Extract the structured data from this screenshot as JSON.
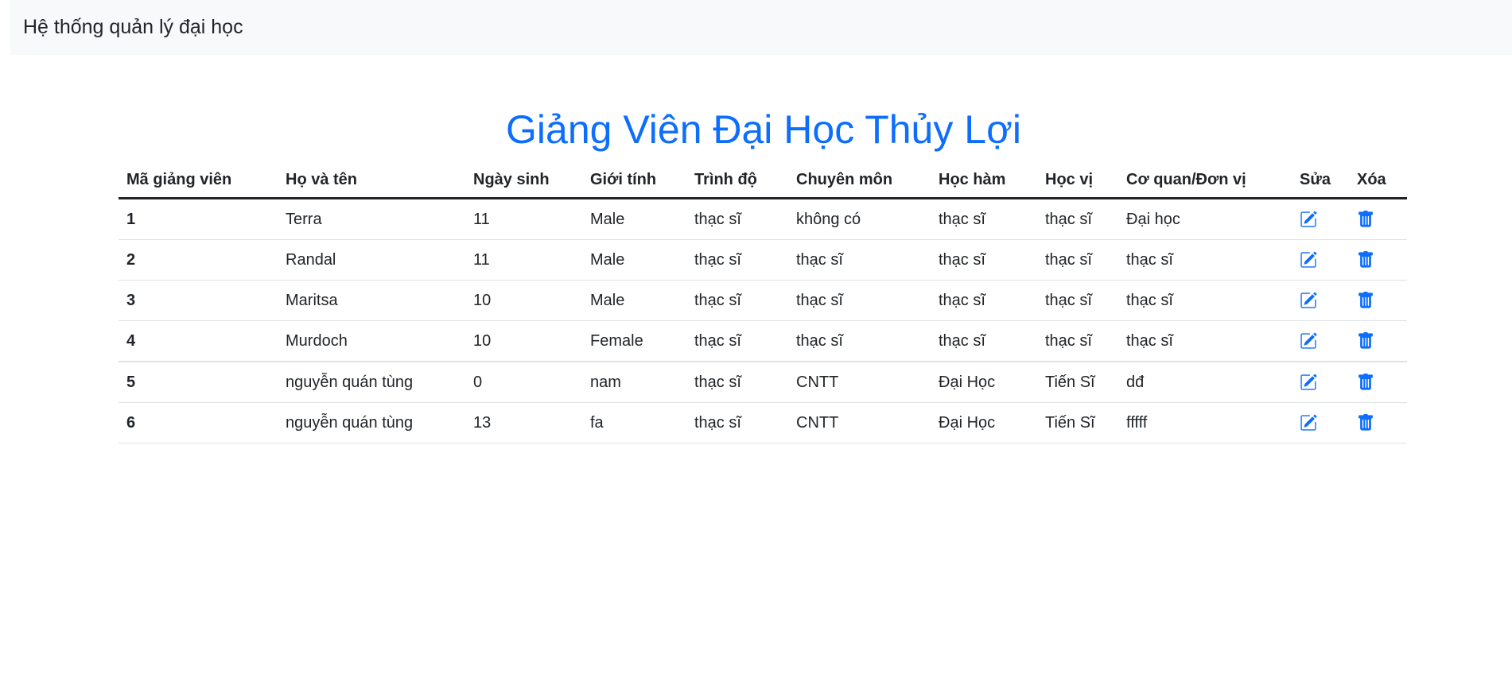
{
  "navbar": {
    "brand": "Hệ thống quản lý đại học"
  },
  "page": {
    "title": "Giảng Viên Đại Học Thủy Lợi"
  },
  "table": {
    "columns": [
      "Mã giảng viên",
      "Họ và tên",
      "Ngày sinh",
      "Giới tính",
      "Trình độ",
      "Chuyên môn",
      "Học hàm",
      "Học vị",
      "Cơ quan/Đơn vị",
      "Sửa",
      "Xóa"
    ],
    "rows": [
      {
        "id": "1",
        "name": "Terra",
        "dob": "11",
        "gender": "Male",
        "level": "thạc sĩ",
        "major": "không có",
        "rank": "thạc sĩ",
        "degree": "thạc sĩ",
        "unit": "Đại học"
      },
      {
        "id": "2",
        "name": "Randal",
        "dob": "11",
        "gender": "Male",
        "level": "thạc sĩ",
        "major": "thạc sĩ",
        "rank": "thạc sĩ",
        "degree": "thạc sĩ",
        "unit": "thạc sĩ"
      },
      {
        "id": "3",
        "name": "Maritsa",
        "dob": "10",
        "gender": "Male",
        "level": "thạc sĩ",
        "major": "thạc sĩ",
        "rank": "thạc sĩ",
        "degree": "thạc sĩ",
        "unit": "thạc sĩ"
      },
      {
        "id": "4",
        "name": "Murdoch",
        "dob": "10",
        "gender": "Female",
        "level": "thạc sĩ",
        "major": "thạc sĩ",
        "rank": "thạc sĩ",
        "degree": "thạc sĩ",
        "unit": "thạc sĩ"
      },
      {
        "id": "5",
        "name": "nguyễn quán tùng",
        "dob": "0",
        "gender": "nam",
        "level": "thạc sĩ",
        "major": "CNTT",
        "rank": "Đại Học",
        "degree": "Tiến Sĩ",
        "unit": "dđ"
      },
      {
        "id": "6",
        "name": "nguyễn quán tùng",
        "dob": "13",
        "gender": "fa",
        "level": "thạc sĩ",
        "major": "CNTT",
        "rank": "Đại Học",
        "degree": "Tiến Sĩ",
        "unit": "fffff"
      }
    ]
  },
  "icons": {
    "edit": "edit-icon",
    "delete": "trash-icon"
  },
  "colors": {
    "accent": "#0d6efd",
    "navbar_bg": "#f8f9fa",
    "text": "#212529",
    "border": "#dee2e6"
  }
}
